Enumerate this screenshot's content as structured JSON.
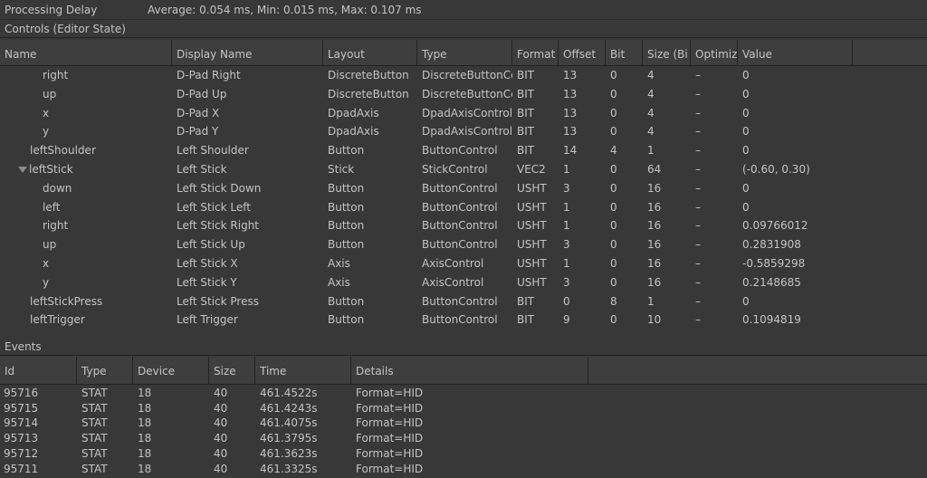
{
  "status": {
    "label": "Processing Delay",
    "stats": "Average: 0.054 ms, Min: 0.015 ms, Max: 0.107 ms"
  },
  "controls": {
    "section_title": "Controls (Editor State)",
    "columns": [
      "Name",
      "Display Name",
      "Layout",
      "Type",
      "Format",
      "Offset",
      "Bit",
      "Size (Bi",
      "Optimiz",
      "Value"
    ],
    "rows": [
      {
        "name": "right",
        "display": "D-Pad Right",
        "layout": "DiscreteButton",
        "type": "DiscreteButtonCc",
        "format": "BIT",
        "offset": "13",
        "bit": "0",
        "size": "4",
        "optim": "–",
        "value": "0"
      },
      {
        "name": "up",
        "display": "D-Pad Up",
        "layout": "DiscreteButton",
        "type": "DiscreteButtonCc",
        "format": "BIT",
        "offset": "13",
        "bit": "0",
        "size": "4",
        "optim": "–",
        "value": "0"
      },
      {
        "name": "x",
        "display": "D-Pad X",
        "layout": "DpadAxis",
        "type": "DpadAxisControl",
        "format": "BIT",
        "offset": "13",
        "bit": "0",
        "size": "4",
        "optim": "–",
        "value": "0"
      },
      {
        "name": "y",
        "display": "D-Pad Y",
        "layout": "DpadAxis",
        "type": "DpadAxisControl",
        "format": "BIT",
        "offset": "13",
        "bit": "0",
        "size": "4",
        "optim": "–",
        "value": "0"
      },
      {
        "name": "leftShoulder",
        "display": "Left Shoulder",
        "layout": "Button",
        "type": "ButtonControl",
        "format": "BIT",
        "offset": "14",
        "bit": "4",
        "size": "1",
        "optim": "–",
        "value": "0"
      },
      {
        "name": "leftStick",
        "display": "Left Stick",
        "layout": "Stick",
        "type": "StickControl",
        "format": "VEC2",
        "offset": "1",
        "bit": "0",
        "size": "64",
        "optim": "–",
        "value": "(-0.60, 0.30)"
      },
      {
        "name": "down",
        "display": "Left Stick Down",
        "layout": "Button",
        "type": "ButtonControl",
        "format": "USHT",
        "offset": "3",
        "bit": "0",
        "size": "16",
        "optim": "–",
        "value": "0"
      },
      {
        "name": "left",
        "display": "Left Stick Left",
        "layout": "Button",
        "type": "ButtonControl",
        "format": "USHT",
        "offset": "1",
        "bit": "0",
        "size": "16",
        "optim": "–",
        "value": "0"
      },
      {
        "name": "right",
        "display": "Left Stick Right",
        "layout": "Button",
        "type": "ButtonControl",
        "format": "USHT",
        "offset": "1",
        "bit": "0",
        "size": "16",
        "optim": "–",
        "value": "0.09766012"
      },
      {
        "name": "up",
        "display": "Left Stick Up",
        "layout": "Button",
        "type": "ButtonControl",
        "format": "USHT",
        "offset": "3",
        "bit": "0",
        "size": "16",
        "optim": "–",
        "value": "0.2831908"
      },
      {
        "name": "x",
        "display": "Left Stick X",
        "layout": "Axis",
        "type": "AxisControl",
        "format": "USHT",
        "offset": "1",
        "bit": "0",
        "size": "16",
        "optim": "–",
        "value": "-0.5859298"
      },
      {
        "name": "y",
        "display": "Left Stick Y",
        "layout": "Axis",
        "type": "AxisControl",
        "format": "USHT",
        "offset": "3",
        "bit": "0",
        "size": "16",
        "optim": "–",
        "value": "0.2148685"
      },
      {
        "name": "leftStickPress",
        "display": "Left Stick Press",
        "layout": "Button",
        "type": "ButtonControl",
        "format": "BIT",
        "offset": "0",
        "bit": "8",
        "size": "1",
        "optim": "–",
        "value": "0"
      },
      {
        "name": "leftTrigger",
        "display": "Left Trigger",
        "layout": "Button",
        "type": "ButtonControl",
        "format": "BIT",
        "offset": "9",
        "bit": "0",
        "size": "10",
        "optim": "–",
        "value": "0.1094819"
      }
    ]
  },
  "events": {
    "section_title": "Events",
    "columns": [
      "Id",
      "Type",
      "Device",
      "Size",
      "Time",
      "Details"
    ],
    "rows": [
      {
        "id": "95716",
        "type": "STAT",
        "device": "18",
        "size": "40",
        "time": "461.4522s",
        "details": "Format=HID"
      },
      {
        "id": "95715",
        "type": "STAT",
        "device": "18",
        "size": "40",
        "time": "461.4243s",
        "details": "Format=HID"
      },
      {
        "id": "95714",
        "type": "STAT",
        "device": "18",
        "size": "40",
        "time": "461.4075s",
        "details": "Format=HID"
      },
      {
        "id": "95713",
        "type": "STAT",
        "device": "18",
        "size": "40",
        "time": "461.3795s",
        "details": "Format=HID"
      },
      {
        "id": "95712",
        "type": "STAT",
        "device": "18",
        "size": "40",
        "time": "461.3623s",
        "details": "Format=HID"
      },
      {
        "id": "95711",
        "type": "STAT",
        "device": "18",
        "size": "40",
        "time": "461.3325s",
        "details": "Format=HID"
      }
    ]
  }
}
